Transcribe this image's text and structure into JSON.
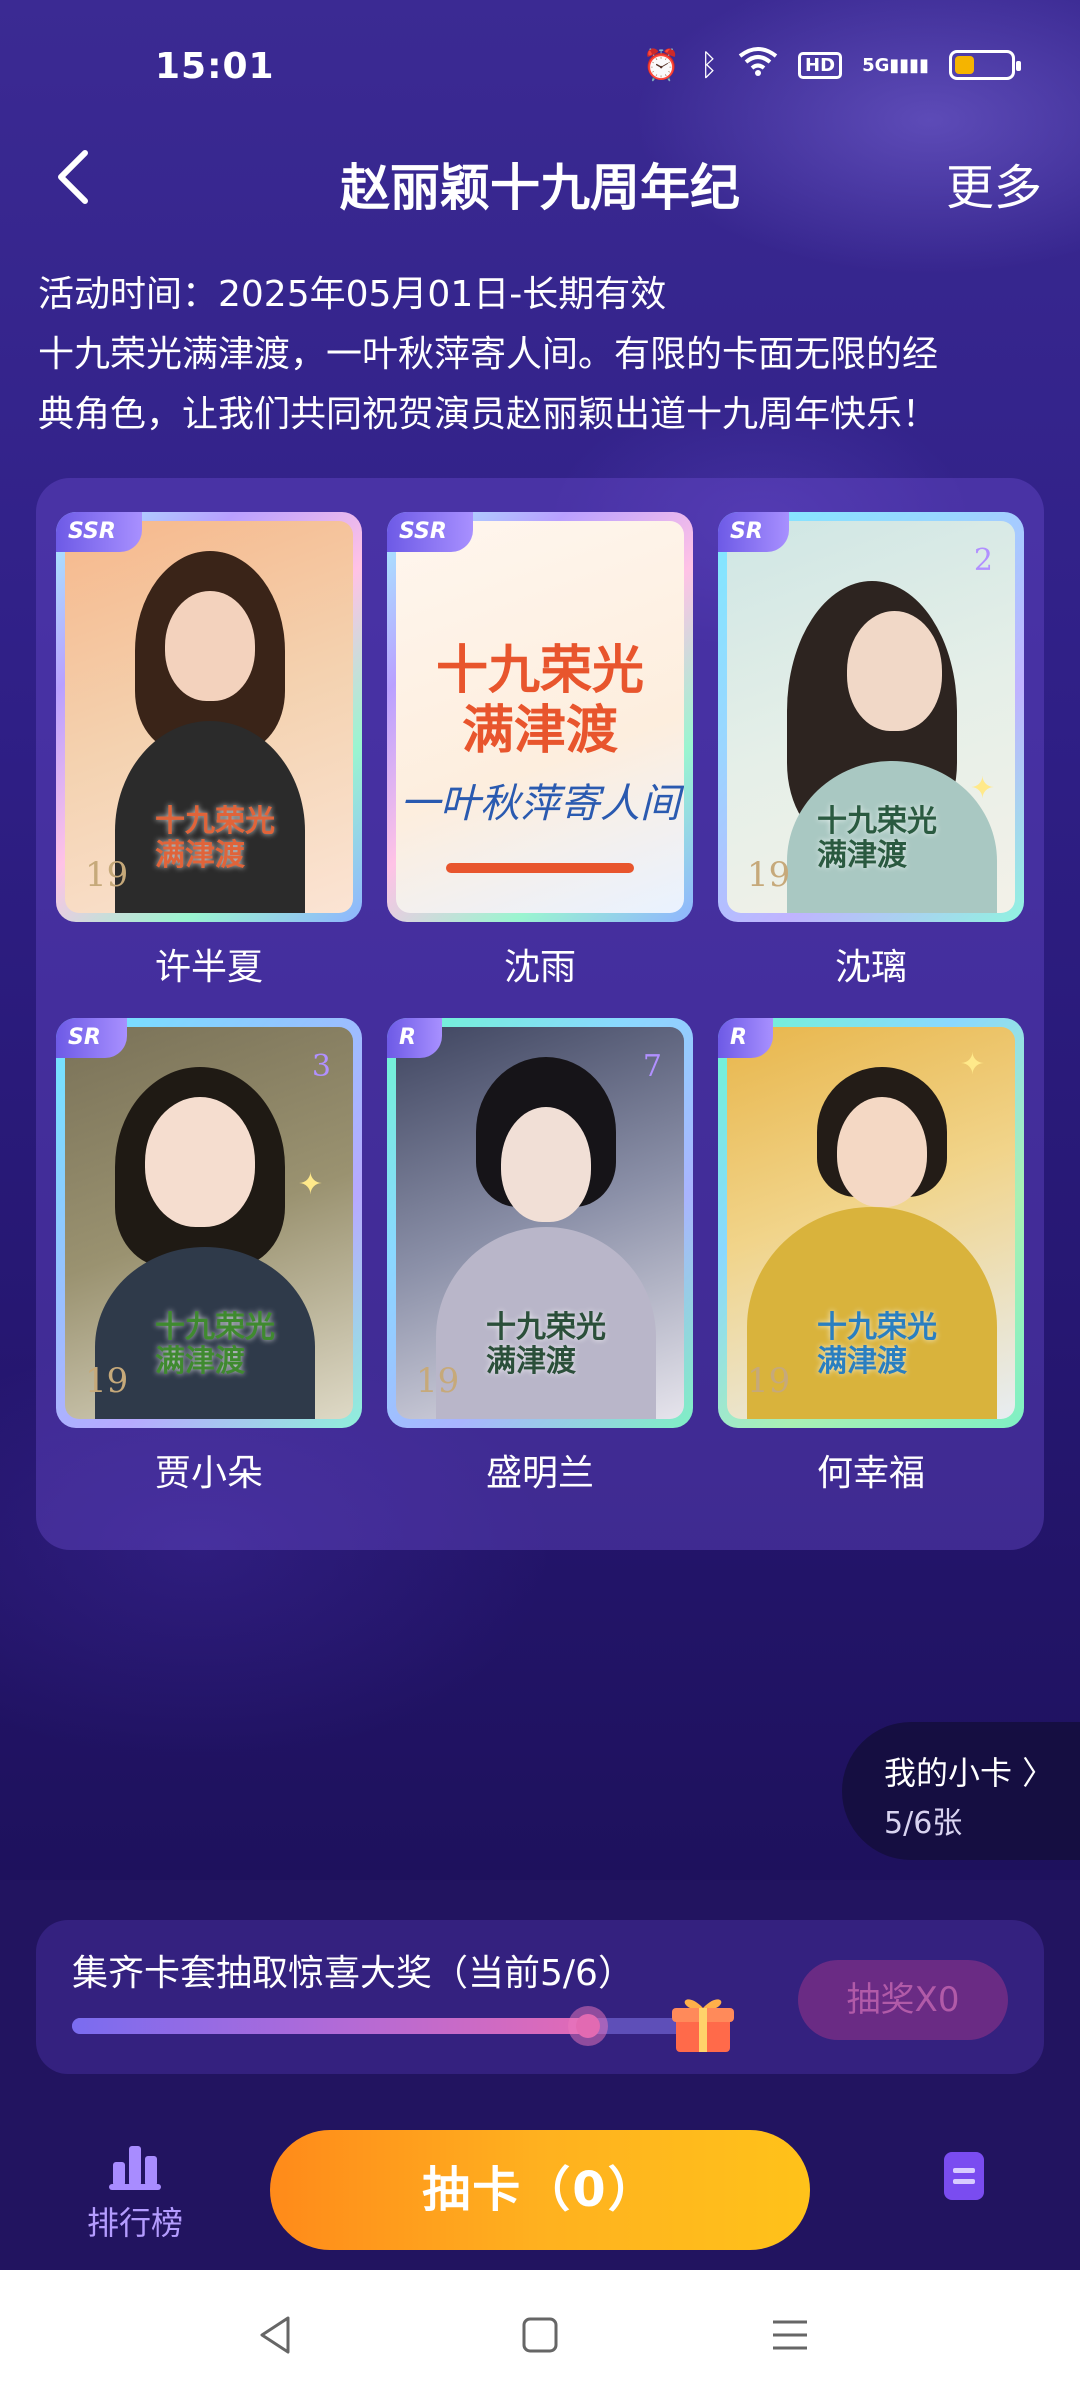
{
  "status_bar": {
    "time": "15:01",
    "network": "5G",
    "hd": "HD",
    "battery_level": 0.35
  },
  "header": {
    "title": "赵丽颖十九周年纪",
    "more_label": "更多"
  },
  "activity": {
    "time_line": "活动时间：2025年05月01日-长期有效",
    "desc_line1": "十九荣光满津渡，一叶秋萍寄人间。有限的卡面无限的经",
    "desc_line2": "典角色，让我们共同祝贺演员赵丽颖出道十九周年快乐！"
  },
  "cards": [
    {
      "name": "许半夏",
      "rarity": "SSR",
      "number": "",
      "badge": "19",
      "logo": "十九荣光\n满津渡",
      "theme": "warm"
    },
    {
      "name": "沈雨",
      "rarity": "SSR",
      "number": "",
      "badge": "",
      "logo": "",
      "theme": "poster",
      "poster_title": "十九荣光\n满津渡",
      "poster_sub": "一叶秋萍寄人间"
    },
    {
      "name": "沈璃",
      "rarity": "SR",
      "number": "2",
      "badge": "19",
      "logo": "十九荣光\n满津渡",
      "theme": "mint"
    },
    {
      "name": "贾小朵",
      "rarity": "SR",
      "number": "3",
      "badge": "19",
      "logo": "十九荣光\n满津渡",
      "theme": "olive"
    },
    {
      "name": "盛明兰",
      "rarity": "R",
      "number": "7",
      "badge": "19",
      "logo": "十九荣光\n满津渡",
      "theme": "grey"
    },
    {
      "name": "何幸福",
      "rarity": "R",
      "number": "",
      "badge": "19",
      "logo": "十九荣光\n满津渡",
      "theme": "golden"
    }
  ],
  "my_cards": {
    "title": "我的小卡 〉",
    "count": "5/6张"
  },
  "collect": {
    "title": "集齐卡套抽取惊喜大奖（当前5/6）",
    "progress": 0.833,
    "lottery_label": "抽奖X0"
  },
  "bottom": {
    "rank_label": "排行榜",
    "draw_label": "抽卡（0）"
  },
  "colors": {
    "accent": "#ffb11f",
    "panel": "#34217f",
    "rank": "#b49cff"
  }
}
